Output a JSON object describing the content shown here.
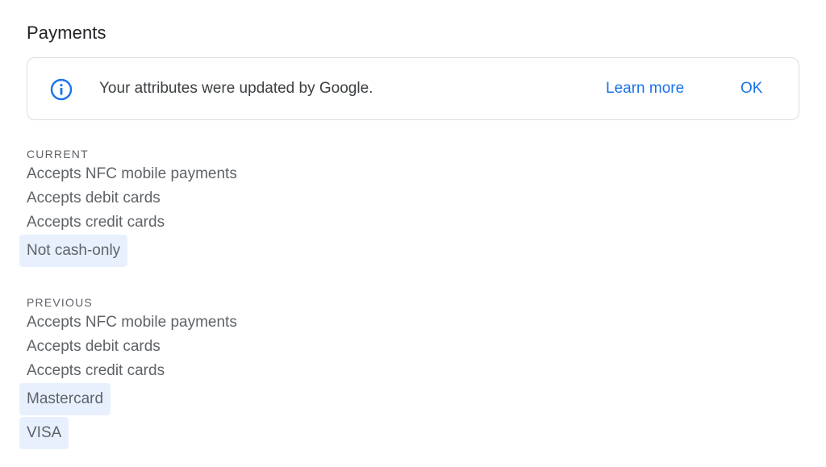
{
  "section_title": "Payments",
  "banner": {
    "icon": "info-icon",
    "message": "Your attributes were updated by Google.",
    "learn_more_label": "Learn more",
    "ok_label": "OK",
    "accent_color": "#1a73e8"
  },
  "current": {
    "label": "CURRENT",
    "attributes": [
      "Accepts NFC mobile payments",
      "Accepts debit cards",
      "Accepts credit cards"
    ],
    "highlighted": [
      "Not cash-only"
    ]
  },
  "previous": {
    "label": "PREVIOUS",
    "attributes": [
      "Accepts NFC mobile payments",
      "Accepts debit cards",
      "Accepts credit cards"
    ],
    "highlighted": [
      "Mastercard",
      "VISA"
    ]
  },
  "highlight_color": "#e8f0fe"
}
